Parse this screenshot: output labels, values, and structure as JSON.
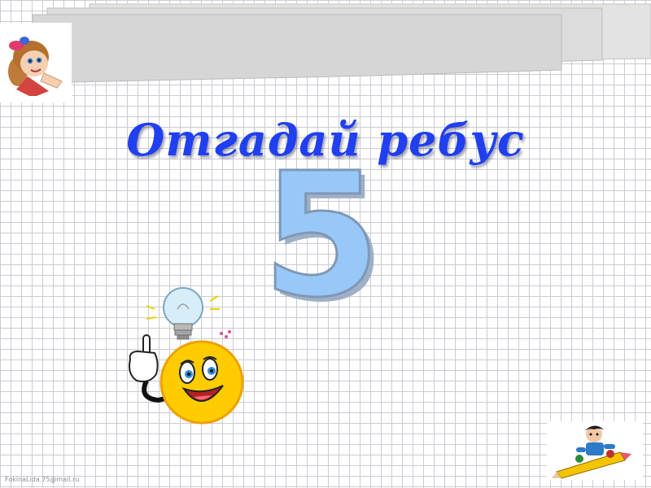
{
  "slide": {
    "title": "Отгадай ребус",
    "rebus_character": "5",
    "watermark": "FokinaLida.75@mail.ru"
  },
  "colors": {
    "title": "#1f3ff0",
    "rebus_fill": "#98c8f7",
    "rebus_edge": "#7f98b6",
    "grid_lines": "#c9ccd3",
    "smiley_face": "#ffcc00"
  },
  "icons": [
    "girl-cartoon-icon",
    "light-bulb-icon",
    "smiley-face-icon",
    "pointing-hand-icon",
    "boy-on-pencil-icon"
  ]
}
